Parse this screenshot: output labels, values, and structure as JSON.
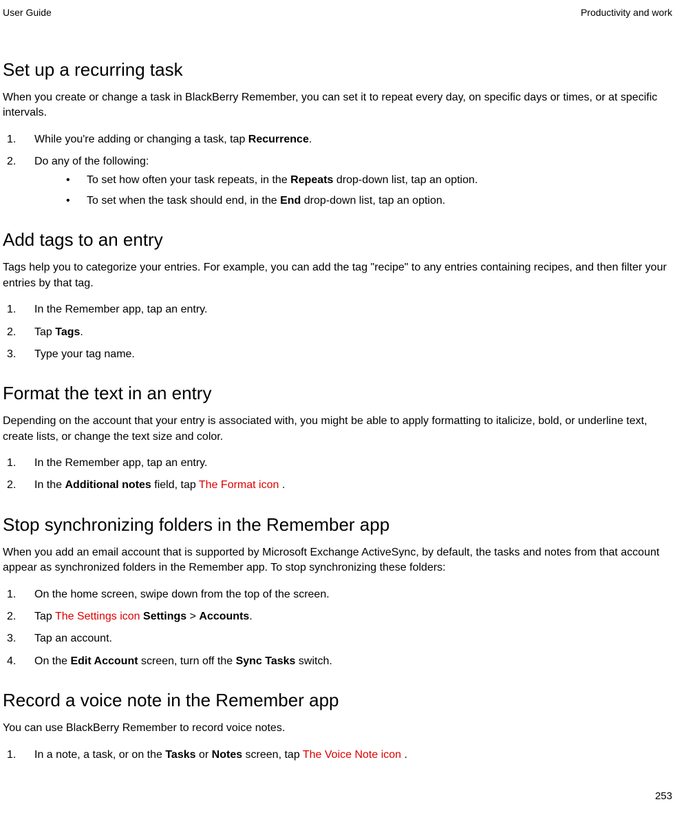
{
  "header": {
    "left": "User Guide",
    "right": "Productivity and work"
  },
  "s1": {
    "title": "Set up a recurring task",
    "intro": "When you create or change a task in BlackBerry Remember, you can set it to repeat every day, on specific days or times, or at specific intervals.",
    "step1_pre": "While you're adding or changing a task, tap ",
    "step1_bold": "Recurrence",
    "step1_post": ".",
    "step2": "Do any of the following:",
    "b1_pre": "To set how often your task repeats, in the ",
    "b1_bold": "Repeats",
    "b1_post": " drop-down list, tap an option.",
    "b2_pre": "To set when the task should end, in the ",
    "b2_bold": "End",
    "b2_post": " drop-down list, tap an option."
  },
  "s2": {
    "title": "Add tags to an entry",
    "intro": "Tags help you to categorize your entries. For example, you can add the tag \"recipe\" to any entries containing recipes, and then filter your entries by that tag.",
    "step1": "In the Remember app, tap an entry.",
    "step2_pre": "Tap ",
    "step2_bold": "Tags",
    "step2_post": ".",
    "step3": "Type your tag name."
  },
  "s3": {
    "title": "Format the text in an entry",
    "intro": "Depending on the account that your entry is associated with, you might be able to apply formatting to italicize, bold, or underline text, create lists, or change the text size and color.",
    "step1": "In the Remember app, tap an entry.",
    "step2_pre": "In the ",
    "step2_bold": "Additional notes",
    "step2_mid": " field, tap  ",
    "step2_icon": "The Format icon",
    "step2_post": " ."
  },
  "s4": {
    "title": "Stop synchronizing folders in the Remember app",
    "intro": "When you add an email account that is supported by Microsoft Exchange ActiveSync, by default, the tasks and notes from that account appear as synchronized folders in the Remember app. To stop synchronizing these folders:",
    "step1": "On the home screen, swipe down from the top of the screen.",
    "step2_pre": "Tap  ",
    "step2_icon": "The Settings icon",
    "step2_mid": "  ",
    "step2_bold1": "Settings",
    "step2_sep": " > ",
    "step2_bold2": "Accounts",
    "step2_post": ".",
    "step3": "Tap an account.",
    "step4_pre": "On the ",
    "step4_bold1": "Edit Account",
    "step4_mid": " screen, turn off the ",
    "step4_bold2": "Sync Tasks",
    "step4_post": " switch."
  },
  "s5": {
    "title": "Record a voice note in the Remember app",
    "intro": "You can use BlackBerry Remember to record voice notes.",
    "step1_pre": "In a note, a task, or on the ",
    "step1_bold1": "Tasks",
    "step1_mid": " or ",
    "step1_bold2": "Notes",
    "step1_mid2": " screen, tap  ",
    "step1_icon": "The Voice Note icon",
    "step1_post": " ."
  },
  "page_number": "253"
}
